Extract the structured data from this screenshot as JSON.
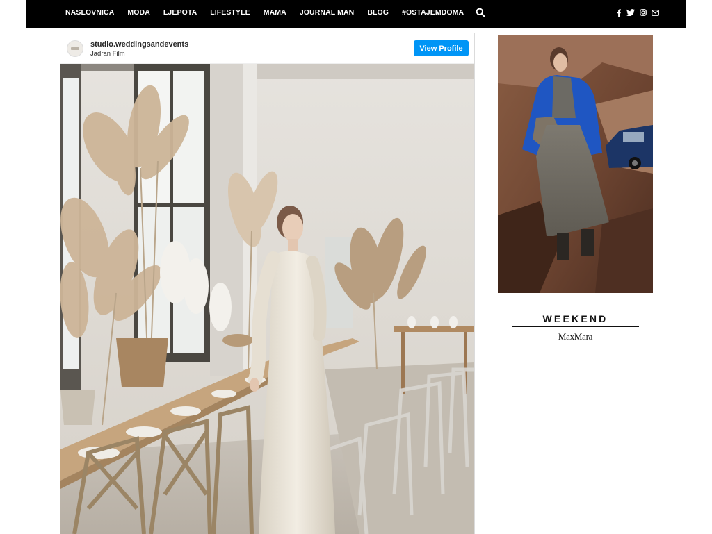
{
  "nav": {
    "items": [
      "NASLOVNICA",
      "MODA",
      "LJEPOTA",
      "LIFESTYLE",
      "MAMA",
      "JOURNAL MAN",
      "BLOG",
      "#OSTAJEMDOMA"
    ],
    "search_icon": "search-icon",
    "social": [
      "facebook-icon",
      "twitter-icon",
      "instagram-icon",
      "mail-icon"
    ]
  },
  "embed": {
    "username": "studio.weddingsandevents",
    "location": "Jadran Film",
    "view_profile_label": "View Profile",
    "button_color": "#0095f6"
  },
  "ad": {
    "brand_line1": "WEEKEND",
    "brand_line2": "MaxMara"
  }
}
